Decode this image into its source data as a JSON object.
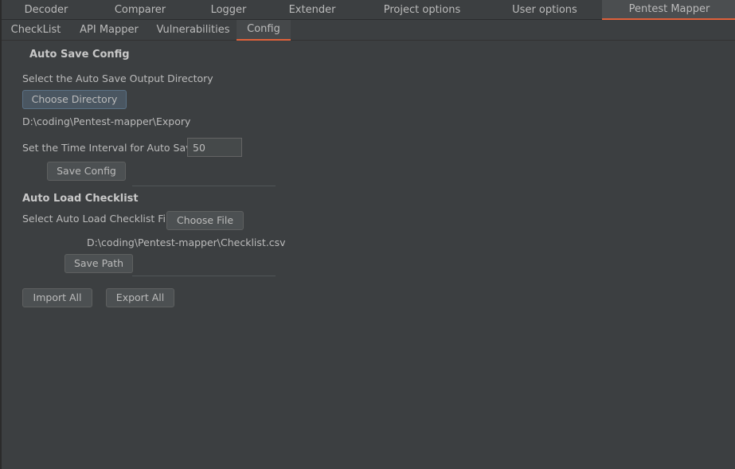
{
  "main_tabs": [
    {
      "label": "Decoder"
    },
    {
      "label": "Comparer"
    },
    {
      "label": "Logger"
    },
    {
      "label": "Extender"
    },
    {
      "label": "Project options"
    },
    {
      "label": "User options"
    },
    {
      "label": "Pentest Mapper"
    }
  ],
  "main_tabs_selected": "Pentest Mapper",
  "sub_tabs": [
    {
      "label": "CheckList"
    },
    {
      "label": "API Mapper"
    },
    {
      "label": "Vulnerabilities"
    },
    {
      "label": "Config"
    }
  ],
  "sub_tabs_selected": "Config",
  "auto_save": {
    "heading": "Auto Save Config",
    "directory_label": "Select the Auto Save Output Directory",
    "choose_directory_button": "Choose Directory",
    "directory_path": "D:\\coding\\Pentest-mapper\\Expory",
    "interval_label": "Set the Time Interval for Auto Save",
    "interval_value": "50",
    "save_config_button": "Save Config"
  },
  "auto_load": {
    "heading": "Auto Load Checklist",
    "file_label": "Select Auto Load Checklist File",
    "choose_file_button": "Choose File",
    "file_path": "D:\\coding\\Pentest-mapper\\Checklist.csv",
    "save_path_button": "Save Path"
  },
  "actions": {
    "import_all_button": "Import All",
    "export_all_button": "Export All"
  },
  "colors": {
    "background": "#3c3f41",
    "accent": "#e0613a",
    "text": "#bbbbbb"
  }
}
